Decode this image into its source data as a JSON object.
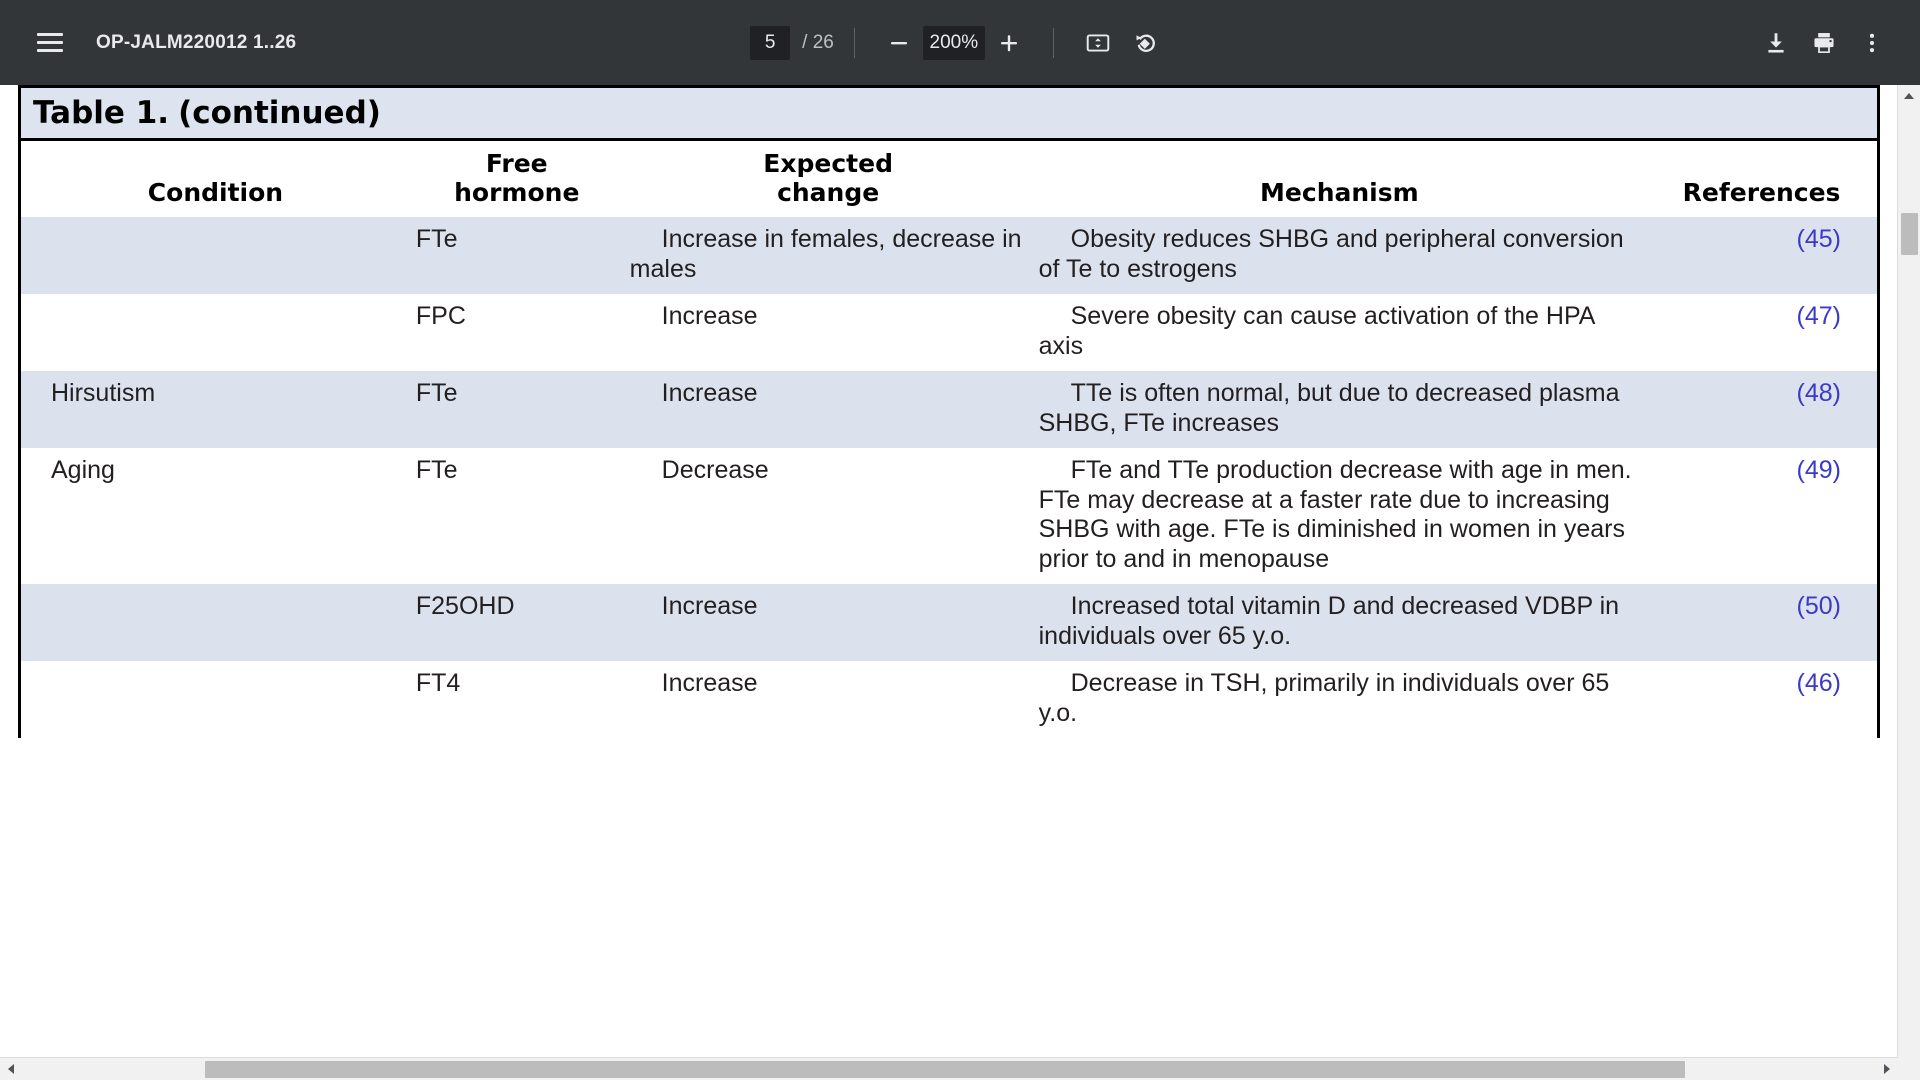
{
  "toolbar": {
    "menu_icon": "hamburger-menu-icon",
    "document_title": "OP-JALM220012 1..26",
    "page_current": "5",
    "page_separator": "/ 26",
    "page_total": "26",
    "zoom_out_icon": "minus-icon",
    "zoom_level": "200%",
    "zoom_in_icon": "plus-icon",
    "fit_icon": "fit-to-page-icon",
    "rotate_icon": "rotate-counterclockwise-icon",
    "download_icon": "download-icon",
    "print_icon": "print-icon",
    "more_icon": "more-options-icon"
  },
  "document": {
    "table": {
      "caption_label": "Table 1.",
      "caption_continued": "(continued)",
      "headers": {
        "condition": "Condition",
        "free_hormone_line1": "Free",
        "free_hormone_line2": "hormone",
        "expected_line1": "Expected",
        "expected_line2": "change",
        "mechanism": "Mechanism",
        "references": "References"
      },
      "rows": [
        {
          "condition": "",
          "free_hormone": "FTe",
          "expected_change": "Increase in females, decrease in males",
          "mechanism": "Obesity reduces SHBG and peripheral conversion of Te to estrogens",
          "reference": "(45)",
          "shaded": true
        },
        {
          "condition": "",
          "free_hormone": "FPC",
          "expected_change": "Increase",
          "mechanism": "Severe obesity can cause activation of the HPA axis",
          "reference": "(47)",
          "shaded": false
        },
        {
          "condition": "Hirsutism",
          "free_hormone": "FTe",
          "expected_change": "Increase",
          "mechanism": "TTe is often normal, but due to decreased plasma SHBG, FTe increases",
          "reference": "(48)",
          "shaded": true
        },
        {
          "condition": "Aging",
          "free_hormone": "FTe",
          "expected_change": "Decrease",
          "mechanism": "FTe and TTe production decrease with age in men. FTe may decrease at a faster rate due to increasing SHBG with age. FTe is diminished in women in years prior to and in menopause",
          "reference": "(49)",
          "shaded": false
        },
        {
          "condition": "",
          "free_hormone": "F25OHD",
          "expected_change": "Increase",
          "mechanism": "Increased total vitamin D and decreased VDBP in individuals over 65 y.o.",
          "reference": "(50)",
          "shaded": true
        },
        {
          "condition": "",
          "free_hormone": "FT4",
          "expected_change": "Increase",
          "mechanism": "Decrease in TSH, primarily in individuals over 65 y.o.",
          "reference": "(46)",
          "shaded": false
        }
      ]
    }
  },
  "scrollbars": {
    "vertical_up_icon": "scroll-up-arrow-icon",
    "vertical_down_icon": "scroll-down-arrow-icon",
    "horizontal_left_icon": "scroll-left-arrow-icon",
    "horizontal_right_icon": "scroll-right-arrow-icon"
  },
  "colors": {
    "toolbar_bg": "#323639",
    "shaded_row": "#dbe2ee",
    "caption_bg": "#dde3ef",
    "reference_link": "#3b39c8"
  }
}
